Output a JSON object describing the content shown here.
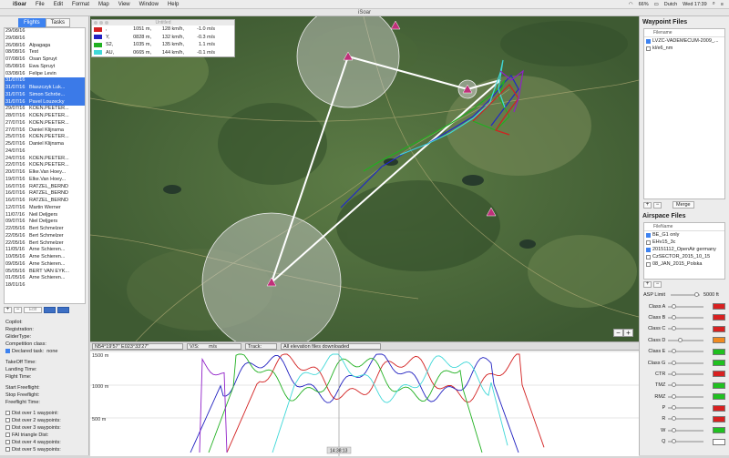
{
  "menubar": {
    "apple": "",
    "app_name": "iSoar",
    "menus": [
      "File",
      "Edit",
      "Format",
      "Map",
      "View",
      "Window",
      "Help"
    ],
    "battery": "66%",
    "input_lang": "Dutch",
    "clock": "Wed 17:39"
  },
  "window": {
    "title": "iSoar"
  },
  "sidebar": {
    "tabs": [
      {
        "label": "Flights",
        "active": true
      },
      {
        "label": "Tasks",
        "active": false
      }
    ],
    "flights": [
      {
        "date": "29/08/16",
        "name": ""
      },
      {
        "date": "29/08/16",
        "name": ""
      },
      {
        "date": "26/08/16",
        "name": "Alpagaga"
      },
      {
        "date": "08/08/16",
        "name": "Test"
      },
      {
        "date": "07/08/16",
        "name": "Osan Spruyt"
      },
      {
        "date": "05/08/16",
        "name": "Ewa Spruyt"
      },
      {
        "date": "03/08/16",
        "name": "Felipe Levin"
      },
      {
        "date": "31/07/16",
        "name": "",
        "sel": true
      },
      {
        "date": "31/07/16",
        "name": "Błaszczyk Luk...",
        "sel": true
      },
      {
        "date": "31/07/16",
        "name": "Simon Schröe...",
        "sel": true
      },
      {
        "date": "31/07/16",
        "name": "Pavel Louzecky",
        "sel": true
      },
      {
        "date": "29/07/16",
        "name": "KOEN.PEETER..."
      },
      {
        "date": "28/07/16",
        "name": "KOEN.PEETER..."
      },
      {
        "date": "27/07/16",
        "name": "KOEN.PEETER..."
      },
      {
        "date": "27/07/16",
        "name": "Daniel Klijnsma"
      },
      {
        "date": "25/07/16",
        "name": "KOEN.PEETER..."
      },
      {
        "date": "25/07/16",
        "name": "Daniel Klijnsma"
      },
      {
        "date": "24/07/16",
        "name": ""
      },
      {
        "date": "24/07/16",
        "name": "KOEN.PEETER..."
      },
      {
        "date": "22/07/16",
        "name": "KOEN.PEETER..."
      },
      {
        "date": "20/07/16",
        "name": "Elke.Van Hoey..."
      },
      {
        "date": "19/07/16",
        "name": "Elke.Van Hoey..."
      },
      {
        "date": "16/07/16",
        "name": "RATZEL_BERND"
      },
      {
        "date": "16/07/16",
        "name": "RATZEL_BERND"
      },
      {
        "date": "16/07/16",
        "name": "RATZEL_BERND"
      },
      {
        "date": "12/07/16",
        "name": "Martin Werner"
      },
      {
        "date": "11/07/16",
        "name": "Neil Deljgers"
      },
      {
        "date": "09/07/16",
        "name": "Niel Deljgers"
      },
      {
        "date": "22/05/16",
        "name": "Bert Schmelzer"
      },
      {
        "date": "22/05/16",
        "name": "Bert Schmelzer"
      },
      {
        "date": "22/05/16",
        "name": "Bert Schmelzer"
      },
      {
        "date": "11/05/16",
        "name": "Arne Schieren..."
      },
      {
        "date": "10/05/16",
        "name": "Arne Schieren..."
      },
      {
        "date": "09/05/16",
        "name": "Arne Schieren..."
      },
      {
        "date": "05/05/16",
        "name": "BERT VAN EYK..."
      },
      {
        "date": "01/05/16",
        "name": "Arne Schieren..."
      },
      {
        "date": "18/01/16",
        "name": ""
      },
      {
        "date": "",
        "name": ""
      }
    ],
    "list_buttons": {
      "add": "+",
      "remove": "−",
      "edit": "Edit"
    },
    "info": {
      "copilot": "Copilot:",
      "registration": "Registration:",
      "glider_type": "GliderType:",
      "competition_class": "Competition class:",
      "declared_task_label": "Declared task:",
      "declared_task_value": "none",
      "takeoff": "TakeOff Time:",
      "landing": "Landing Time:",
      "flight": "Flight Time:",
      "start_freeflight": "Start Freeflight:",
      "stop_freeflight": "Stop Freeflight:",
      "freeflight_time": "Freeflight Time:",
      "dist_checks": [
        "Dist over 1 waypoint:",
        "Dist over 2 waypoints:",
        "Dist over 3 waypoints:",
        "FAI triangle Dist:",
        "Dist over 4 waypoints:",
        "Dist over 5 waypoints:"
      ]
    }
  },
  "legend": {
    "title": "Untitled",
    "rows": [
      {
        "color": "#d22020",
        "id": ",",
        "alt": "1051 m,",
        "speed": "128 km/h,",
        "vario": "-1.0 m/s"
      },
      {
        "color": "#2020c0",
        "id": "Y,",
        "alt": "0828 m,",
        "speed": "132 km/h,",
        "vario": "-0.3 m/s"
      },
      {
        "color": "#20b020",
        "id": "S2,",
        "alt": "1035 m,",
        "speed": "135 km/h,",
        "vario": "1.1 m/s"
      },
      {
        "color": "#40d8d8",
        "id": "AU,",
        "alt": "0665 m,",
        "speed": "144 km/h,",
        "vario": "-0.1 m/s"
      }
    ]
  },
  "statusbar": {
    "coords": "N54°19'57\"  E023°33'27\"",
    "vs_label": "V/S:",
    "vs_unit": "m/s",
    "track_label": "Track:",
    "message": "All elevation files downloaded"
  },
  "altgraph": {
    "label_1500": "1500 m",
    "label_1000": "1000 m",
    "label_500": "500 m",
    "time_marker": "14:38:13"
  },
  "rightpane": {
    "waypoint_title": "Waypoint Files",
    "waypoint_header": "Filename",
    "waypoint_files": [
      {
        "name": "LVZC-VADEMECUM-2009_...",
        "checked": true
      },
      {
        "name": "kl/e6_nm",
        "checked": false
      }
    ],
    "merge_label": "Merge",
    "airspace_title": "Airspace Files",
    "airspace_header": "FileName",
    "airspace_files": [
      {
        "name": "BE_G1 only",
        "checked": true
      },
      {
        "name": "EHv15_3c",
        "checked": false
      },
      {
        "name": "20151112_OpenAir germany",
        "checked": true
      },
      {
        "name": "CzSECTOR_2015_10_15",
        "checked": false
      },
      {
        "name": "08_JAN_2015_Polska",
        "checked": false
      }
    ],
    "asp_limit_label": "ASP Limit",
    "asp_limit_value": "5000 ft",
    "classes": [
      {
        "label": "Class A",
        "color": "#d82020",
        "level": 0.12
      },
      {
        "label": "Class B",
        "color": "#d82020",
        "level": 0.12
      },
      {
        "label": "Class C",
        "color": "#d82020",
        "level": 0.12
      },
      {
        "label": "Class D",
        "color": "#f08a20",
        "level": 0.3
      },
      {
        "label": "Class E",
        "color": "#20c020",
        "level": 0.12
      },
      {
        "label": "Class G",
        "color": "#20c020",
        "level": 0.12
      },
      {
        "label": "CTR",
        "color": "#d82020",
        "level": 0.12
      },
      {
        "label": "TMZ",
        "color": "#20c020",
        "level": 0.12
      },
      {
        "label": "RMZ",
        "color": "#20c020",
        "level": 0.12
      },
      {
        "label": "P",
        "color": "#d82020",
        "level": 0.12
      },
      {
        "label": "R",
        "color": "#d82020",
        "level": 0.12
      },
      {
        "label": "W",
        "color": "#20c020",
        "level": 0.12
      },
      {
        "label": "Q",
        "color": "#ffffff",
        "level": 0.12
      }
    ]
  },
  "zoom": {
    "minus": "−",
    "plus": "+"
  }
}
